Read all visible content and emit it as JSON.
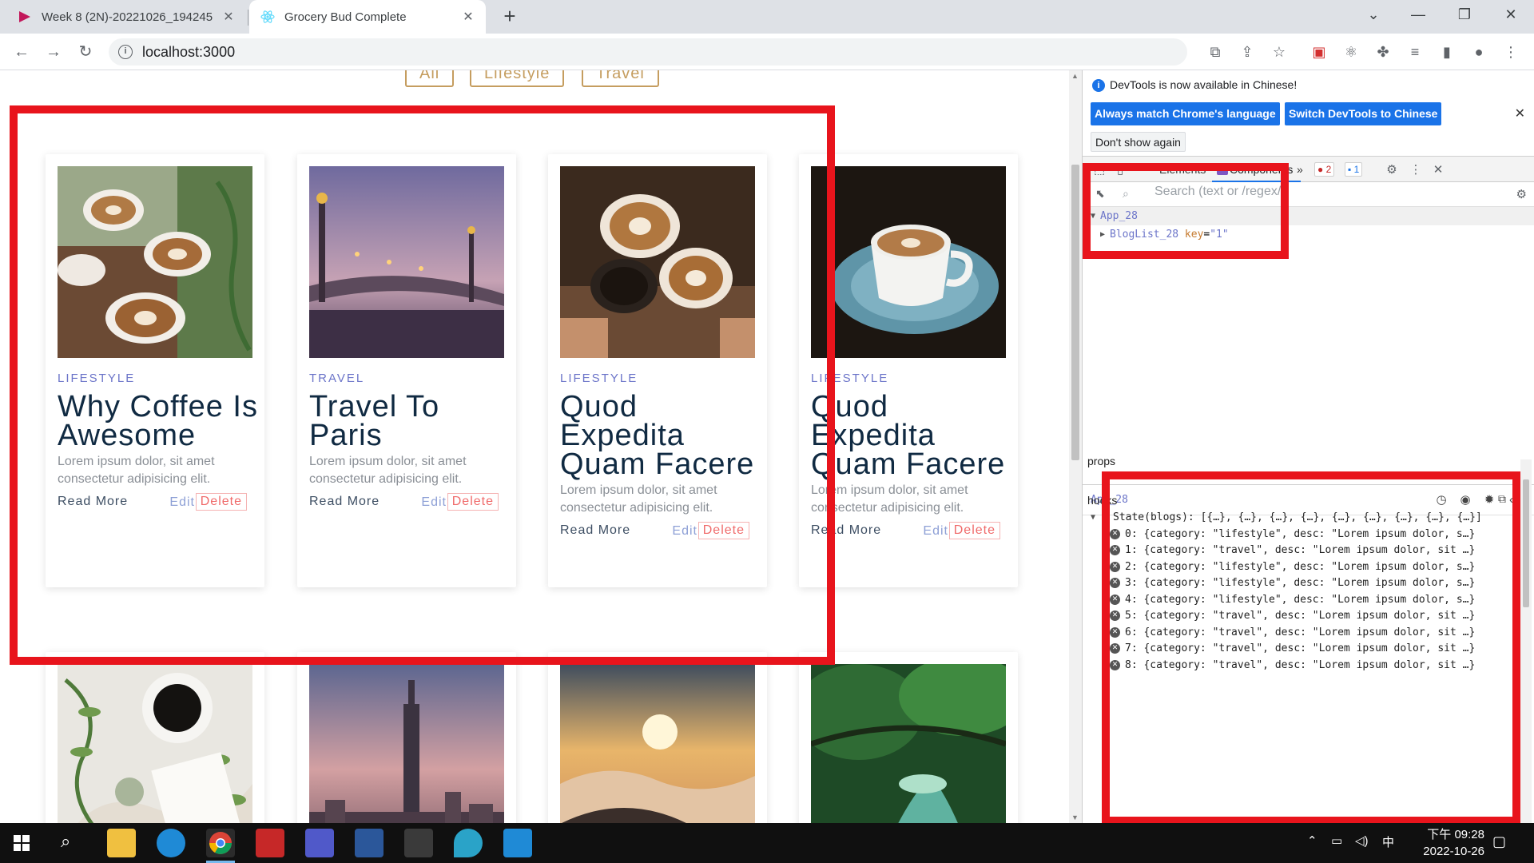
{
  "browser": {
    "tabs": [
      {
        "title": "Week 8 (2N)-20221026_194245",
        "active": false
      },
      {
        "title": "Grocery Bud Complete",
        "active": true
      }
    ],
    "url": "localhost:3000"
  },
  "page": {
    "filters": [
      "All",
      "Lifestyle",
      "Travel"
    ],
    "read_more": "Read More",
    "edit": "Edit",
    "delete": "Delete",
    "cards": [
      {
        "category": "LIFESTYLE",
        "title": "Why Coffee Is Awesome",
        "desc": "Lorem ipsum dolor, sit amet consectetur adipisicing elit.",
        "image": "coffee-cups"
      },
      {
        "category": "TRAVEL",
        "title": "Travel To Paris",
        "desc": "Lorem ipsum dolor, sit amet consectetur adipisicing elit.",
        "image": "paris-bridge"
      },
      {
        "category": "LIFESTYLE",
        "title": "Quod Expedita Quam Facere",
        "desc": "Lorem ipsum dolor, sit amet consectetur adipisicing elit.",
        "image": "coffee-cheers"
      },
      {
        "category": "LIFESTYLE",
        "title": "Quod Expedita Quam Facere",
        "desc": "Lorem ipsum dolor, sit amet consectetur adipisicing elit.",
        "image": "coffee-saucer"
      },
      {
        "image": "coffee-plant"
      },
      {
        "image": "taipei-101"
      },
      {
        "image": "sunrise-clouds"
      },
      {
        "image": "forest-river"
      }
    ]
  },
  "devtools": {
    "info": "DevTools is now available in Chinese!",
    "btn_match": "Always match Chrome's language",
    "btn_switch": "Switch DevTools to Chinese",
    "btn_dont_show": "Don't show again",
    "tab_elements": "Elements",
    "tab_components": "Components",
    "more_tabs": "»",
    "error_count": "2",
    "message_count": "1",
    "search_placeholder": "Search (text or /regex/)",
    "tree": {
      "root": "App_28",
      "child": "BlogList_28",
      "child_key_attr": "key",
      "child_key_val": "\"1\""
    },
    "selected_component": "App_28",
    "props_label": "props",
    "hooks_label": "hooks",
    "state_line": "State(blogs): [{…}, {…}, {…}, {…}, {…}, {…}, {…}, {…}, {…}]",
    "state_items": [
      "0: {category: \"lifestyle\", desc: \"Lorem ipsum dolor, s…}",
      "1: {category: \"travel\", desc: \"Lorem ipsum dolor, sit …}",
      "2: {category: \"lifestyle\", desc: \"Lorem ipsum dolor, s…}",
      "3: {category: \"lifestyle\", desc: \"Lorem ipsum dolor, s…}",
      "4: {category: \"lifestyle\", desc: \"Lorem ipsum dolor, s…}",
      "5: {category: \"travel\", desc: \"Lorem ipsum dolor, sit …}",
      "6: {category: \"travel\", desc: \"Lorem ipsum dolor, sit …}",
      "7: {category: \"travel\", desc: \"Lorem ipsum dolor, sit …}",
      "8: {category: \"travel\", desc: \"Lorem ipsum dolor, sit …}"
    ]
  },
  "taskbar": {
    "time": "下午 09:28",
    "date": "2022-10-26",
    "ime": "中"
  },
  "colors": {
    "annotation_red": "#e8141c",
    "category": "#6c75c9",
    "title": "#102a42",
    "filter_gold": "#c59d5f"
  }
}
